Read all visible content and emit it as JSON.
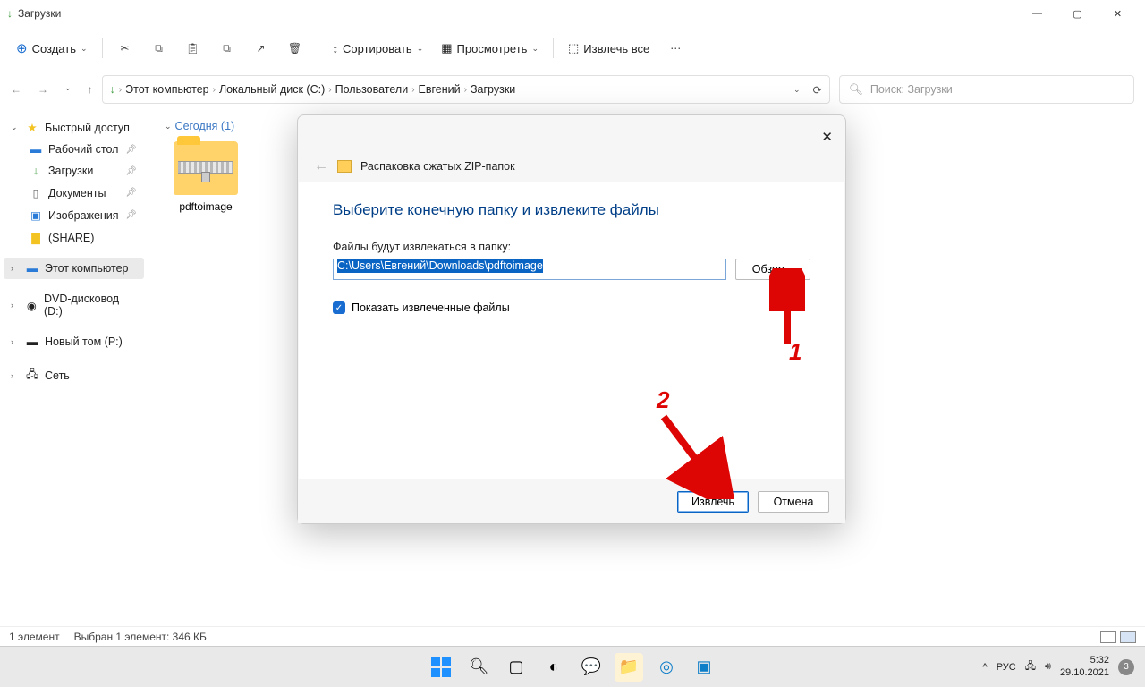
{
  "window": {
    "title": "Загрузки"
  },
  "toolbar": {
    "create": "Создать",
    "sort": "Сортировать",
    "view": "Просмотреть",
    "extract_all": "Извлечь все"
  },
  "breadcrumbs": [
    "Этот компьютер",
    "Локальный диск (C:)",
    "Пользователи",
    "Евгений",
    "Загрузки"
  ],
  "search": {
    "placeholder": "Поиск: Загрузки"
  },
  "sidebar": {
    "quick_access": "Быстрый доступ",
    "items": [
      {
        "label": "Рабочий стол"
      },
      {
        "label": "Загрузки"
      },
      {
        "label": "Документы"
      },
      {
        "label": "Изображения"
      },
      {
        "label": "(SHARE)"
      }
    ],
    "this_pc": "Этот компьютер",
    "dvd": "DVD-дисковод (D:)",
    "new_volume": "Новый том (P:)",
    "network": "Сеть"
  },
  "content": {
    "group_header": "Сегодня (1)",
    "file_name": "pdftoimage"
  },
  "statusbar": {
    "count": "1 элемент",
    "selected": "Выбран 1 элемент: 346 КБ"
  },
  "dialog": {
    "title": "Распаковка сжатых ZIP-папок",
    "heading": "Выберите конечную папку и извлеките файлы",
    "label": "Файлы будут извлекаться в папку:",
    "path": "C:\\Users\\Евгений\\Downloads\\pdftoimage",
    "browse": "Обзор...",
    "show_extracted": "Показать извлеченные файлы",
    "extract": "Извлечь",
    "cancel": "Отмена"
  },
  "annotations": {
    "one": "1",
    "two": "2"
  },
  "taskbar": {
    "lang": "РУС",
    "time": "5:32",
    "date": "29.10.2021",
    "badge": "3"
  }
}
